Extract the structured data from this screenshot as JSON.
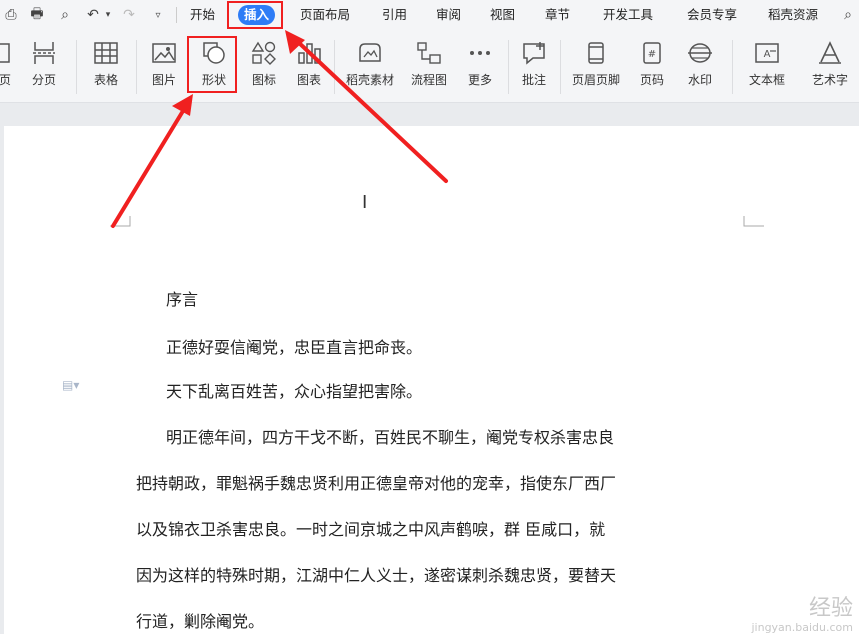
{
  "menu": {
    "tabs": [
      "开始",
      "插入",
      "页面布局",
      "引用",
      "审阅",
      "视图",
      "章节",
      "开发工具",
      "会员专享",
      "稻壳资源"
    ],
    "active_tab": "插入"
  },
  "ribbon": {
    "items": [
      {
        "label": "页"
      },
      {
        "label": "分页"
      },
      {
        "label": "表格"
      },
      {
        "label": "图片"
      },
      {
        "label": "形状"
      },
      {
        "label": "图标"
      },
      {
        "label": "图表"
      },
      {
        "label": "稻壳素材"
      },
      {
        "label": "流程图"
      },
      {
        "label": "更多"
      },
      {
        "label": "批注"
      },
      {
        "label": "页眉页脚"
      },
      {
        "label": "页码"
      },
      {
        "label": "水印"
      },
      {
        "label": "文本框"
      },
      {
        "label": "艺术字"
      }
    ]
  },
  "document": {
    "title": "序言",
    "lines": [
      "正德好耍信阉党，忠臣直言把命丧。",
      "天下乱离百姓苦，众心指望把害除。",
      "明正德年间，四方干戈不断，百姓民不聊生，阉党专权杀害忠良",
      "把持朝政，罪魁祸手魏忠贤利用正德皇帝对他的宠幸，指使东厂西厂",
      "以及锦衣卫杀害忠良。一时之间京城之中风声鹤唳，群 臣咸口，就",
      "因为这样的特殊时期，江湖中仁人义士，遂密谋刺杀魏忠贤，要替天",
      "行道，剿除阉党。"
    ]
  },
  "watermark": {
    "brand": "经验",
    "url": "jingyan.baidu.com"
  },
  "colors": {
    "accent": "#2e7cf6",
    "highlight": "#f02020"
  }
}
